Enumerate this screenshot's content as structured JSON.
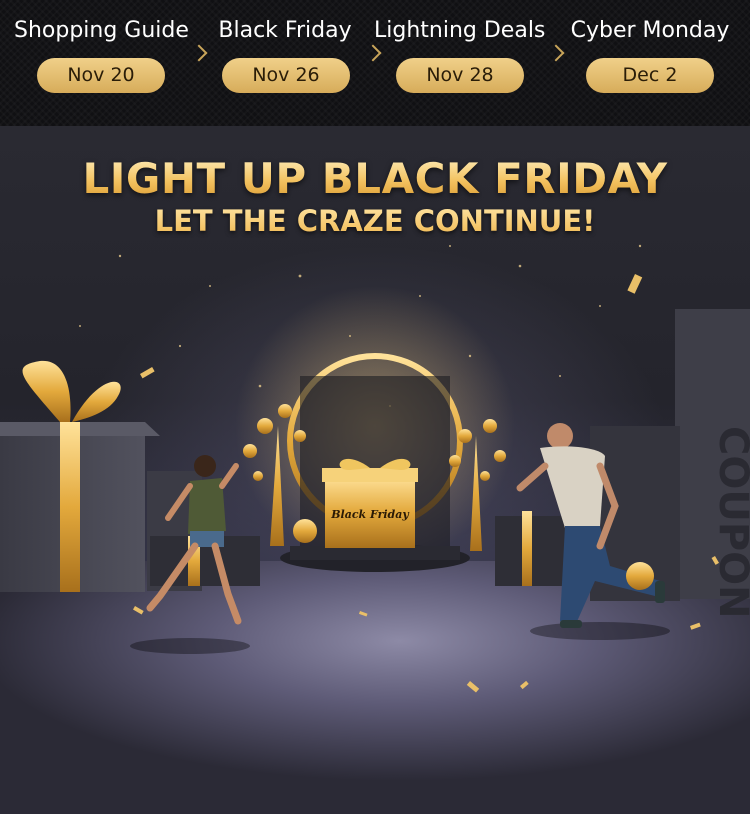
{
  "timeline": {
    "steps": [
      {
        "title": "Shopping Guide",
        "date": "Nov 20"
      },
      {
        "title": "Black Friday",
        "date": "Nov 26"
      },
      {
        "title": "Lightning Deals",
        "date": "Nov 28"
      },
      {
        "title": "Cyber Monday",
        "date": "Dec 2"
      }
    ]
  },
  "hero": {
    "headline": "LIGHT UP BLACK FRIDAY",
    "subheadline": "LET THE CRAZE CONTINUE!",
    "podium_gift_logo": "Black Friday",
    "coupon_wall_text": "COUPON"
  },
  "colors": {
    "gold": "#e9bf68",
    "pill": "#e4bb6d",
    "dark": "#15151a"
  }
}
